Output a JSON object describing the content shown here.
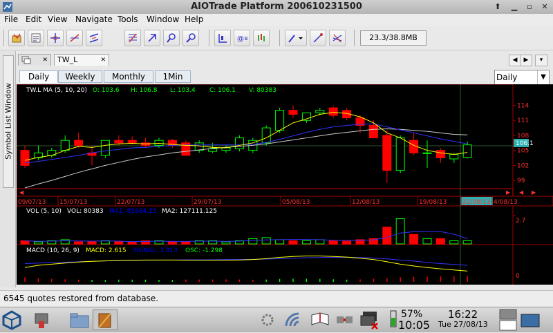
{
  "window": {
    "title": "AIOTrade Platform 200610231500"
  },
  "menubar": {
    "items": [
      "File",
      "Edit",
      "View",
      "Navigate",
      "Tools",
      "Window",
      "Help"
    ]
  },
  "toolbar": {
    "buttons": [
      "open-icon",
      "save-icon",
      "crosshair-icon",
      "line-icon",
      "parallel-icon",
      "fib-icon",
      "zoom-in-icon",
      "zoom-out-icon",
      "candle-icon",
      "ohlc-icon",
      "line-chart-icon",
      "pen-icon",
      "trend-icon",
      "cycle-icon"
    ],
    "memory": "23.3/38.8MB"
  },
  "sidebar": {
    "label": "Symbol List Window"
  },
  "doc_tabs": [
    {
      "label": "",
      "icon": "pages-icon"
    },
    {
      "label": "TW_L"
    }
  ],
  "freq_tabs": [
    "Daily",
    "Weekly",
    "Monthly",
    "1Min"
  ],
  "freq_select": {
    "value": "Daily"
  },
  "quote_panel": {
    "header_name": "TW.L MA (5, 10, 20)",
    "open": "O: 103.6",
    "high": "H: 106.8",
    "low": "L: 103.4",
    "close": "C: 106.1",
    "volume": "V: 80383",
    "current_price": "106.1",
    "y_ticks": [
      "114",
      "111",
      "108",
      "105",
      "102",
      "99"
    ],
    "x_ticks": [
      "09/07/13",
      "15/07/13",
      "22/07/13",
      "29/07/13",
      "05/08/13",
      "12/08/13",
      "19/08/13",
      "22/08/13",
      "4/08/13"
    ]
  },
  "volume_panel": {
    "header_name": "VOL (5, 10)",
    "vol": "VOL: 80383",
    "ma1": "MA1: 85984.25",
    "ma2": "MA2: 127111.125",
    "y_tick": "2.7"
  },
  "macd_panel": {
    "header_name": "MACD (10, 26, 9)",
    "macd": "MACD: 2.615",
    "signal": "SIGNAL: 3.913",
    "osc": "OSC: -1.298",
    "y_tick": "0"
  },
  "chart_data": {
    "type": "candlestick",
    "x_ticks": [
      "09/07/13",
      "15/07/13",
      "22/07/13",
      "29/07/13",
      "05/08/13",
      "12/08/13",
      "19/08/13",
      "22/08/13",
      "4/08/13"
    ],
    "y_ticks": [
      114,
      111,
      108,
      105,
      102,
      99
    ],
    "ylim": [
      97.5,
      116
    ],
    "candles": [
      {
        "o": 105,
        "h": 106,
        "l": 101.5,
        "c": 102
      },
      {
        "o": 103.5,
        "h": 106,
        "l": 103,
        "c": 104.5
      },
      {
        "o": 104,
        "h": 105.5,
        "l": 103.5,
        "c": 105
      },
      {
        "o": 105,
        "h": 108,
        "l": 104.5,
        "c": 107
      },
      {
        "o": 107,
        "h": 108.5,
        "l": 105.5,
        "c": 106
      },
      {
        "o": 104.5,
        "h": 106,
        "l": 102,
        "c": 104
      },
      {
        "o": 104,
        "h": 107,
        "l": 103.5,
        "c": 107
      },
      {
        "o": 107,
        "h": 108,
        "l": 106,
        "c": 106.5
      },
      {
        "o": 107,
        "h": 107.8,
        "l": 106.2,
        "c": 106.5
      },
      {
        "o": 106.5,
        "h": 107.5,
        "l": 105.5,
        "c": 106
      },
      {
        "o": 106,
        "h": 107.5,
        "l": 105.5,
        "c": 107
      },
      {
        "o": 107,
        "h": 107.3,
        "l": 105.5,
        "c": 106
      },
      {
        "o": 106.5,
        "h": 107,
        "l": 104,
        "c": 104
      },
      {
        "o": 105,
        "h": 107,
        "l": 104.5,
        "c": 106.5
      },
      {
        "o": 104.8,
        "h": 106.5,
        "l": 104.5,
        "c": 105.3
      },
      {
        "o": 105,
        "h": 106,
        "l": 104.5,
        "c": 105.5
      },
      {
        "o": 105.3,
        "h": 108,
        "l": 104.8,
        "c": 107.5
      },
      {
        "o": 105,
        "h": 107.5,
        "l": 104.5,
        "c": 107
      },
      {
        "o": 106.5,
        "h": 110,
        "l": 106,
        "c": 109.5
      },
      {
        "o": 109,
        "h": 113.5,
        "l": 108.5,
        "c": 113
      },
      {
        "o": 113,
        "h": 114,
        "l": 111.5,
        "c": 112.2
      },
      {
        "o": 111,
        "h": 112.5,
        "l": 110.5,
        "c": 112.5
      },
      {
        "o": 112.5,
        "h": 113.5,
        "l": 112,
        "c": 113
      },
      {
        "o": 113.5,
        "h": 113.8,
        "l": 111.5,
        "c": 112
      },
      {
        "o": 113,
        "h": 113.5,
        "l": 111,
        "c": 111.5
      },
      {
        "o": 111.5,
        "h": 112,
        "l": 108.5,
        "c": 110
      },
      {
        "o": 110,
        "h": 111,
        "l": 107.5,
        "c": 107.5
      },
      {
        "o": 108,
        "h": 109,
        "l": 98.5,
        "c": 101
      },
      {
        "o": 101,
        "h": 108,
        "l": 100.5,
        "c": 107.5
      },
      {
        "o": 107,
        "h": 108.5,
        "l": 104,
        "c": 104.5
      },
      {
        "o": 104.5,
        "h": 107,
        "l": 101.5,
        "c": 104.5
      },
      {
        "o": 105,
        "h": 105.5,
        "l": 102.5,
        "c": 103.5
      },
      {
        "o": 103.3,
        "h": 104.5,
        "l": 102.5,
        "c": 104.2
      },
      {
        "o": 103.6,
        "h": 106.8,
        "l": 103.4,
        "c": 106.1
      }
    ],
    "ma5": [
      103,
      103.6,
      104,
      105,
      105.8,
      105.6,
      106,
      106.3,
      106.4,
      106.3,
      106.4,
      106.2,
      106,
      105.9,
      105.6,
      105.5,
      106,
      106.5,
      107.5,
      109,
      110.5,
      111.3,
      112.2,
      112.6,
      112.4,
      111.7,
      110.5,
      108.5,
      107.5,
      106,
      105,
      104.5,
      104.2,
      104.6
    ],
    "ma10": [
      102.5,
      102.8,
      103.2,
      103.6,
      104,
      104.5,
      104.9,
      105.2,
      105.5,
      105.6,
      105.8,
      106,
      106.1,
      106.1,
      106.1,
      106.1,
      106.1,
      106.2,
      106.6,
      107.2,
      107.9,
      108.6,
      109.2,
      109.7,
      110,
      110.2,
      110.3,
      109.7,
      109.1,
      108.5,
      107.9,
      107.3,
      106.8,
      106.3
    ],
    "ma20": [
      97.5,
      98.3,
      99,
      99.8,
      100.6,
      101.3,
      102,
      102.6,
      103.2,
      103.7,
      104.1,
      104.5,
      104.8,
      105.1,
      105.4,
      105.6,
      105.8,
      106,
      106.3,
      106.7,
      107.1,
      107.5,
      107.9,
      108.3,
      108.6,
      108.9,
      109.2,
      109.3,
      109.2,
      109,
      108.8,
      108.5,
      108.2,
      108.1
    ],
    "volume": [
      0.3,
      0.2,
      0.3,
      0.4,
      0.2,
      0.2,
      0.3,
      0.2,
      0.2,
      0.3,
      0.3,
      0.2,
      0.2,
      0.3,
      0.3,
      0.2,
      0.3,
      0.5,
      0.6,
      0.4,
      0.3,
      0.3,
      0.4,
      0.3,
      0.3,
      0.4,
      0.5,
      1.6,
      2.4,
      0.9,
      0.5,
      0.5,
      0.3,
      0.3
    ],
    "macd": [
      0.4,
      0.5,
      0.55,
      0.6,
      0.65,
      0.68,
      0.7,
      0.72,
      0.73,
      0.74,
      0.74,
      0.74,
      0.73,
      0.73,
      0.73,
      0.73,
      0.74,
      0.76,
      0.8,
      0.86,
      0.9,
      0.92,
      0.92,
      0.9,
      0.87,
      0.82,
      0.76,
      0.66,
      0.55,
      0.47,
      0.4,
      0.34,
      0.29,
      0.24
    ],
    "signal": [
      0.58,
      0.6,
      0.62,
      0.64,
      0.66,
      0.68,
      0.7,
      0.71,
      0.72,
      0.73,
      0.74,
      0.74,
      0.75,
      0.75,
      0.75,
      0.76,
      0.76,
      0.77,
      0.78,
      0.8,
      0.82,
      0.84,
      0.85,
      0.86,
      0.86,
      0.85,
      0.83,
      0.79,
      0.74,
      0.69,
      0.63,
      0.58,
      0.54,
      0.5
    ]
  },
  "status": {
    "message": "6545 quotes restored from database."
  },
  "taskbar": {
    "battery": "57%",
    "time_small": "10:05",
    "time": "16:22",
    "date": "Tue 27/08/13"
  },
  "colors": {
    "up": "#00ff00",
    "down": "#ff0000",
    "ma5": "#ffff00",
    "ma10": "#3232ff",
    "ma20": "#cccccc",
    "text_green": "#00ff00",
    "text_blue": "#0000ff",
    "accent_cyan": "#2fb0b0"
  }
}
